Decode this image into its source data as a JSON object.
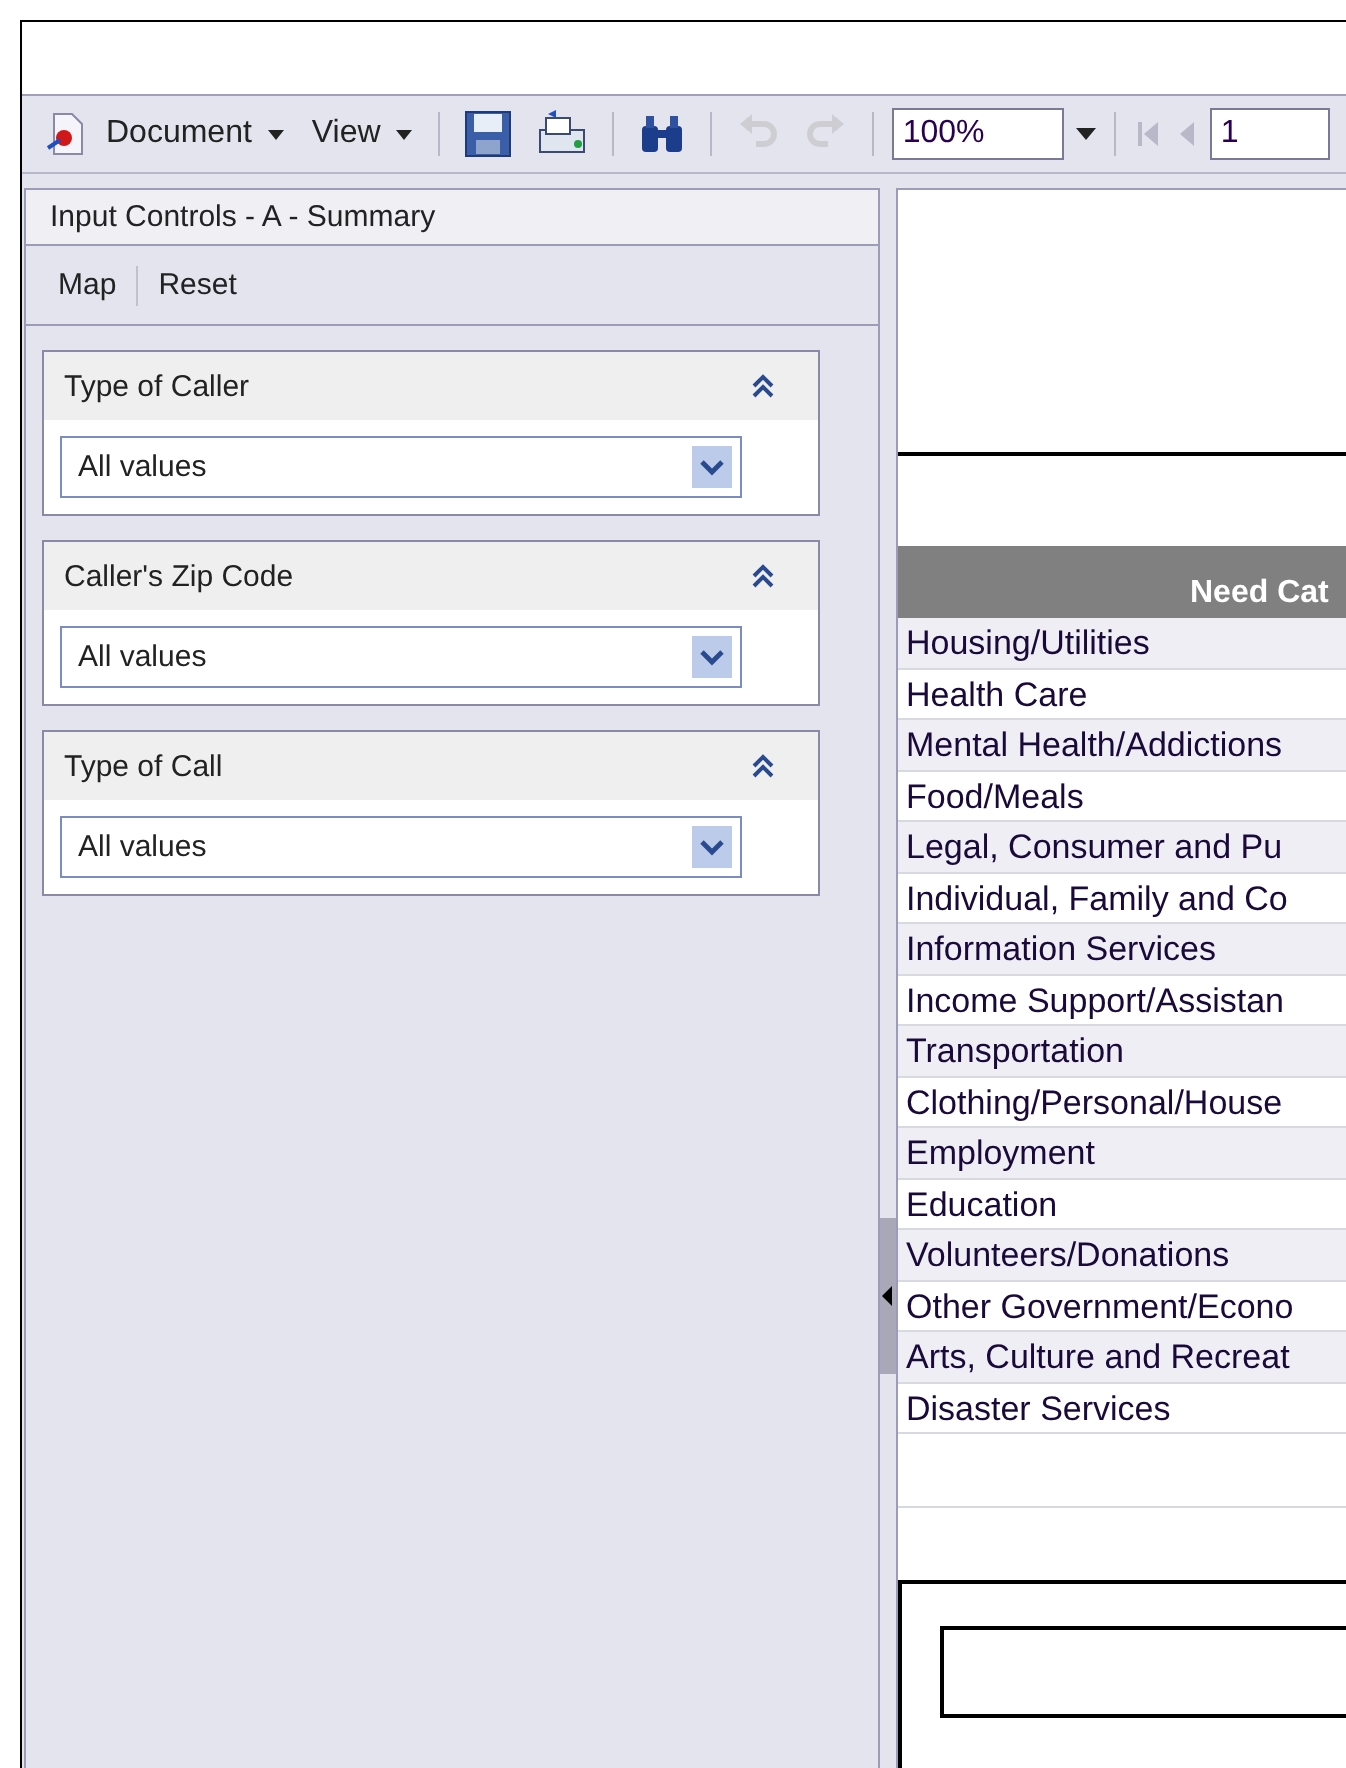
{
  "toolbar": {
    "menus": [
      {
        "label": "Document"
      },
      {
        "label": "View"
      }
    ],
    "buttons": [
      {
        "kind": "save",
        "disabled": false
      },
      {
        "kind": "export",
        "disabled": false
      },
      {
        "kind": "find",
        "disabled": false
      },
      {
        "kind": "undo",
        "disabled": true
      },
      {
        "kind": "redo",
        "disabled": true
      }
    ],
    "zoom": {
      "value": "100%"
    },
    "page_nav": [
      {
        "kind": "first",
        "disabled": true
      },
      {
        "kind": "prev",
        "disabled": true
      }
    ],
    "page": {
      "value": "1"
    }
  },
  "input_panel": {
    "title": "Input Controls - A - Summary",
    "actions": [
      "Map",
      "Reset"
    ],
    "filters": [
      {
        "label": "Type of Caller",
        "value": "All values",
        "expanded": true
      },
      {
        "label": "Caller's Zip Code",
        "value": "All values",
        "expanded": true
      },
      {
        "label": "Type of Call",
        "value": "All values",
        "expanded": true
      }
    ]
  },
  "report": {
    "table": {
      "column": "Need Cat",
      "rows": [
        "Housing/Utilities",
        "Health Care",
        "Mental Health/Addictions",
        "Food/Meals",
        "Legal, Consumer and Pu",
        "Individual, Family and Co",
        "Information Services",
        "Income Support/Assistan",
        "Transportation",
        "Clothing/Personal/House",
        "Employment",
        "Education",
        "Volunteers/Donations",
        "Other Government/Econo",
        "Arts, Culture and Recreat",
        "Disaster Services"
      ]
    }
  }
}
